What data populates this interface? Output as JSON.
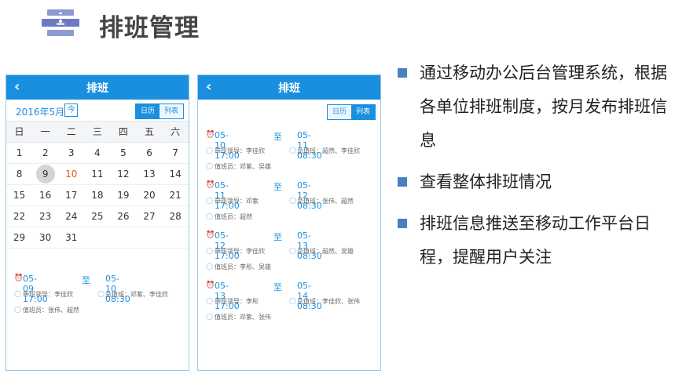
{
  "header": {
    "title": "排班管理",
    "icon": "schedule-doc-icon"
  },
  "phone1": {
    "topbar_title": "排班",
    "month_label": "2016年5月",
    "today_label": "今",
    "view_calendar": "日历",
    "view_list": "列表",
    "weekdays": [
      "日",
      "一",
      "二",
      "三",
      "四",
      "五",
      "六"
    ],
    "weeks": [
      [
        "1",
        "2",
        "3",
        "4",
        "5",
        "6",
        "7"
      ],
      [
        "8",
        "9",
        "10",
        "11",
        "12",
        "13",
        "14"
      ],
      [
        "15",
        "16",
        "17",
        "18",
        "19",
        "20",
        "21"
      ],
      [
        "22",
        "23",
        "24",
        "25",
        "26",
        "27",
        "28"
      ],
      [
        "29",
        "30",
        "31",
        "",
        "",
        "",
        ""
      ]
    ],
    "schedule": {
      "start": "05-09 17:00",
      "to": "至",
      "end": "05-10 08:30",
      "leader": "带班领导：李佳欣",
      "chief": "总值班：邓紫、李佳欣",
      "staff": "值班员：张伟、超然"
    }
  },
  "phone2": {
    "topbar_title": "排班",
    "view_calendar": "日历",
    "view_list": "列表",
    "items": [
      {
        "start": "05-10 17:00",
        "to": "至",
        "end": "05-11 08:30",
        "leader": "带班领导：李佳欣",
        "chief": "总值班：超然、李佳欣",
        "staff": "值班员：邓紫、吴雄"
      },
      {
        "start": "05-11 17:00",
        "to": "至",
        "end": "05-12 08:30",
        "leader": "带班领导：邓紫",
        "chief": "总值班：张伟、超然",
        "staff": "值班员：超然"
      },
      {
        "start": "05-12 17:00",
        "to": "至",
        "end": "05-13 08:30",
        "leader": "带班领导：李佳欣",
        "chief": "总值班：超然、吴雄",
        "staff": "值班员：李彤、吴雄"
      },
      {
        "start": "05-13 17:00",
        "to": "至",
        "end": "05-14 08:30",
        "leader": "带班领导：李彤",
        "chief": "总值班：李佳欣、张伟",
        "staff": "值班员：邓紫、张伟"
      }
    ]
  },
  "bullets": [
    "通过移动办公后台管理系统，根据各单位排班制度，按月发布排班信息",
    "查看整体排班情况",
    "排班信息推送至移动工作平台日程，提醒用户关注"
  ],
  "colors": {
    "accent": "#1a8fe0",
    "today": "#e8560f",
    "bullet": "#4a7fc1"
  }
}
